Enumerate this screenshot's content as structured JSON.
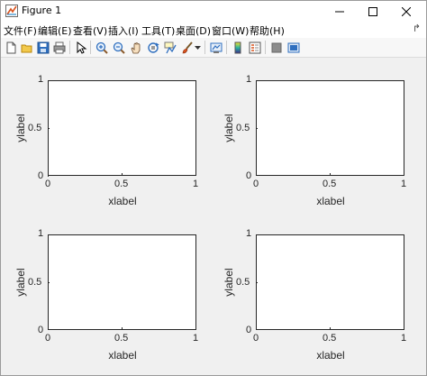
{
  "window": {
    "title": "Figure 1"
  },
  "menu": [
    "文件(F)",
    "编辑(E)",
    "查看(V)",
    "插入(I)",
    "工具(T)",
    "桌面(D)",
    "窗口(W)",
    "帮助(H)"
  ],
  "toolbar": [
    "new-figure",
    "open-file",
    "save",
    "print",
    "pointer",
    "zoom-in",
    "zoom-out",
    "pan",
    "rotate-3d",
    "data-cursor",
    "brush",
    "brush-dropdown",
    "link-plot",
    "insert-colorbar",
    "insert-legend",
    "hide-plot-tools",
    "show-plot-tools"
  ],
  "axes": [
    {
      "xlabel": "xlabel",
      "ylabel": "ylabel",
      "xticks": [
        "0",
        "0.5",
        "1"
      ],
      "yticks": [
        "0",
        "0.5",
        "1"
      ]
    },
    {
      "xlabel": "xlabel",
      "ylabel": "ylabel",
      "xticks": [
        "0",
        "0.5",
        "1"
      ],
      "yticks": [
        "0",
        "0.5",
        "1"
      ]
    },
    {
      "xlabel": "xlabel",
      "ylabel": "ylabel",
      "xticks": [
        "0",
        "0.5",
        "1"
      ],
      "yticks": [
        "0",
        "0.5",
        "1"
      ]
    },
    {
      "xlabel": "xlabel",
      "ylabel": "ylabel",
      "xticks": [
        "0",
        "0.5",
        "1"
      ],
      "yticks": [
        "0",
        "0.5",
        "1"
      ]
    }
  ]
}
